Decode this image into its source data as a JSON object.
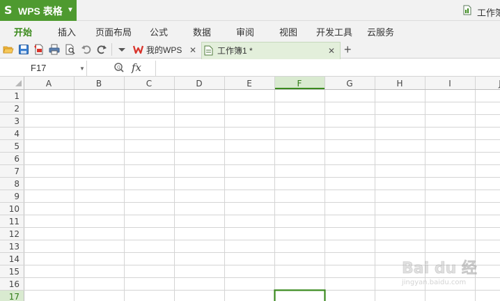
{
  "app": {
    "title": "WPS 表格",
    "logo": "S",
    "colors": {
      "accent": "#4e9a2f",
      "active_tab": "#3b8a1c",
      "selection": "#3a8a1e"
    }
  },
  "window": {
    "document_title": "工作簿"
  },
  "menu": {
    "tabs": [
      "开始",
      "插入",
      "页面布局",
      "公式",
      "数据",
      "审阅",
      "视图",
      "开发工具",
      "云服务"
    ],
    "active": 0
  },
  "toolbar": {
    "icons": [
      "open-folder-icon",
      "save-icon",
      "export-pdf-icon",
      "print-icon",
      "print-preview-icon",
      "undo-icon",
      "redo-icon",
      "more-dropdown-icon"
    ],
    "doc_tabs": [
      {
        "label": "我的WPS",
        "icon": "wps-logo-icon"
      },
      {
        "label": "工作簿1 *",
        "icon": "spreadsheet-doc-icon",
        "active": true
      }
    ],
    "new_tab": "+"
  },
  "formula_bar": {
    "cell_ref": "F17",
    "fx": "fx",
    "value": ""
  },
  "sheet": {
    "columns": [
      "A",
      "B",
      "C",
      "D",
      "E",
      "F",
      "G",
      "H",
      "I",
      "J"
    ],
    "rows": [
      "1",
      "2",
      "3",
      "4",
      "5",
      "6",
      "7",
      "8",
      "9",
      "10",
      "11",
      "12",
      "13",
      "14",
      "15",
      "16",
      "17"
    ],
    "selected_cell": {
      "column": "F",
      "row": "17"
    }
  },
  "watermark": {
    "text": "Bai du 经验",
    "sub": "jingyan.baidu.com"
  }
}
